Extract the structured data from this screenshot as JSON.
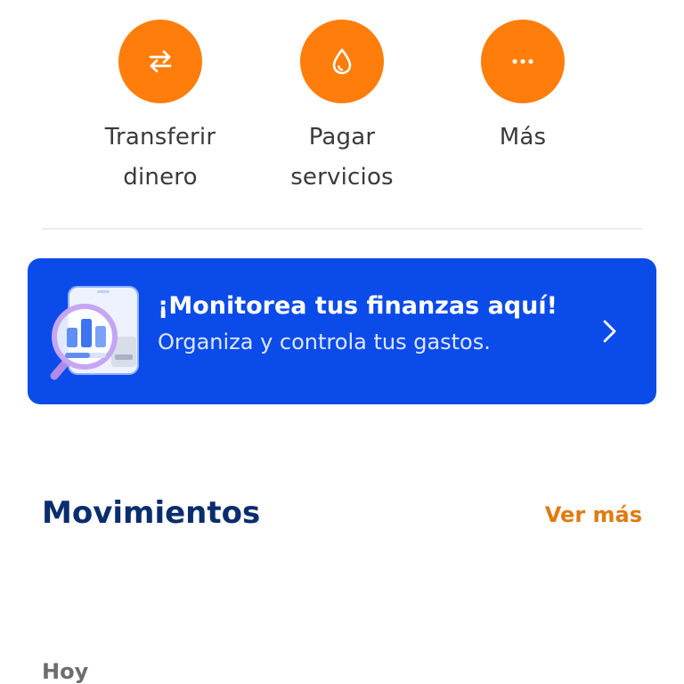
{
  "colors": {
    "accent_orange": "#FF7D0A",
    "banner_blue": "#0B4BEA",
    "title_navy": "#0A2D6E",
    "link_orange": "#E07A12"
  },
  "quick_actions": [
    {
      "label_line1": "Transferir",
      "label_line2": "dinero",
      "icon": "transfer-arrows-icon"
    },
    {
      "label_line1": "Pagar",
      "label_line2": "servicios",
      "icon": "drop-icon"
    },
    {
      "label_line1": "Más",
      "label_line2": "",
      "icon": "more-dots-icon"
    }
  ],
  "banner": {
    "title": "¡Monitorea tus finanzas aquí!",
    "subtitle": "Organiza y controla tus gastos.",
    "icon": "finance-monitor-illustration",
    "chevron": "chevron-right-icon"
  },
  "movements": {
    "title": "Movimientos",
    "see_more": "Ver más",
    "group_label": "Hoy"
  }
}
